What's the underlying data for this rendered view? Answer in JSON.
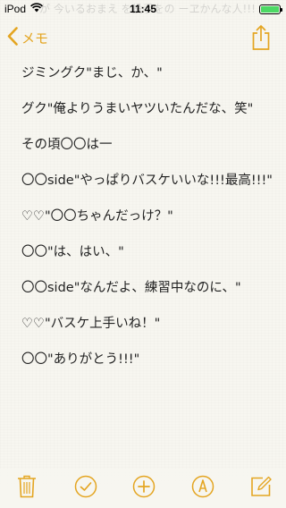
{
  "status_bar": {
    "carrier": "iPod",
    "time": "11:45",
    "battery_level": 1.0,
    "battery_color": "#4cd964"
  },
  "ghost_text": "が 今いるおまえ を投手をの ーヱかんな人!!!",
  "nav": {
    "back_label": "メモ",
    "back_icon": "chevron-left-icon",
    "share_icon": "share-icon",
    "accent_color": "#e4a521"
  },
  "note": {
    "paragraphs": [
      "ジミングク\"まじ、か、\"",
      "グク\"俺よりうまいヤツいたんだな、笑\"",
      "その頃〇〇は一",
      "〇〇side\"やっぱりバスケいいな!!!最高!!!\"",
      "♡♡\"〇〇ちゃんだっけ？\"",
      "〇〇\"は、はい、\"",
      "〇〇side\"なんだよ、練習中なのに、\"",
      "♡♡\"バスケ上手いね！\"",
      "〇〇\"ありがとう!!!\""
    ]
  },
  "toolbar": {
    "items": [
      {
        "name": "trash-icon"
      },
      {
        "name": "checklist-icon"
      },
      {
        "name": "add-icon"
      },
      {
        "name": "markup-icon"
      },
      {
        "name": "compose-icon"
      }
    ]
  }
}
